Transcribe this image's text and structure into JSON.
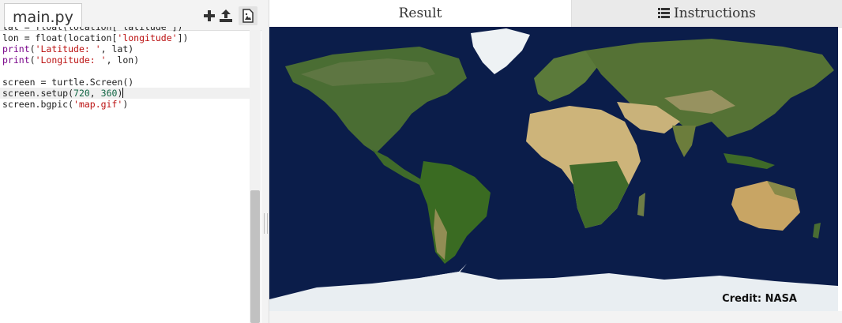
{
  "editor": {
    "file_tab": "main.py",
    "toolbar_icons": [
      "add-file-icon",
      "upload-icon",
      "image-icon"
    ],
    "code_lines": [
      {
        "parts": [
          {
            "t": "lat = float(location['latitude'])",
            "c": ""
          }
        ]
      },
      {
        "parts": [
          {
            "t": "lon = float(location[",
            "c": ""
          },
          {
            "t": "'longitude'",
            "c": "str"
          },
          {
            "t": "])",
            "c": ""
          }
        ]
      },
      {
        "parts": [
          {
            "t": "print",
            "c": "kw"
          },
          {
            "t": "(",
            "c": ""
          },
          {
            "t": "'Latitude: '",
            "c": "str"
          },
          {
            "t": ", lat)",
            "c": ""
          }
        ]
      },
      {
        "parts": [
          {
            "t": "print",
            "c": "kw"
          },
          {
            "t": "(",
            "c": ""
          },
          {
            "t": "'Longitude: '",
            "c": "str"
          },
          {
            "t": ", lon)",
            "c": ""
          }
        ]
      },
      {
        "parts": [
          {
            "t": "",
            "c": ""
          }
        ]
      },
      {
        "parts": [
          {
            "t": "screen = turtle.Screen()",
            "c": ""
          }
        ]
      },
      {
        "parts": [
          {
            "t": "screen.setup(",
            "c": ""
          },
          {
            "t": "720",
            "c": "num"
          },
          {
            "t": ", ",
            "c": ""
          },
          {
            "t": "360",
            "c": "num"
          },
          {
            "t": ")",
            "c": ""
          }
        ],
        "active": true
      },
      {
        "parts": [
          {
            "t": "screen.bgpic(",
            "c": ""
          },
          {
            "t": "'map.gif'",
            "c": "str"
          },
          {
            "t": ")",
            "c": ""
          }
        ]
      }
    ]
  },
  "output": {
    "tabs": {
      "result": "Result",
      "instructions": "Instructions"
    },
    "map_credit": "Credit: NASA"
  },
  "colors": {
    "ocean": "#0b1d4a",
    "land_green": "#3f6a2a",
    "desert": "#c9b27a",
    "ice": "#e9eef2"
  }
}
